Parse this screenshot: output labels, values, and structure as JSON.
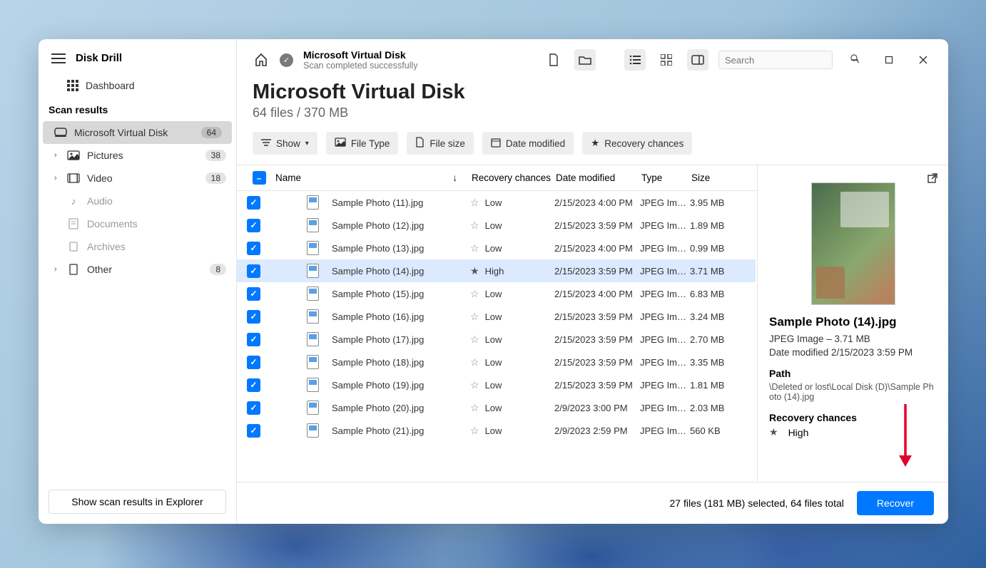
{
  "app": {
    "title": "Disk Drill"
  },
  "sidebar": {
    "dashboard": "Dashboard",
    "section": "Scan results",
    "items": [
      {
        "label": "Microsoft Virtual Disk",
        "badge": "64",
        "active": true
      },
      {
        "label": "Pictures",
        "badge": "38"
      },
      {
        "label": "Video",
        "badge": "18"
      },
      {
        "label": "Audio",
        "dim": true
      },
      {
        "label": "Documents",
        "dim": true
      },
      {
        "label": "Archives",
        "dim": true
      },
      {
        "label": "Other",
        "badge": "8"
      }
    ],
    "explorer_btn": "Show scan results in Explorer"
  },
  "topbar": {
    "disk": "Microsoft Virtual Disk",
    "status": "Scan completed successfully",
    "search_placeholder": "Search"
  },
  "headline": {
    "title": "Microsoft Virtual Disk",
    "sub": "64 files / 370 MB"
  },
  "filters": {
    "show": "Show",
    "file_type": "File Type",
    "file_size": "File size",
    "date_modified": "Date modified",
    "recovery_chances": "Recovery chances"
  },
  "columns": {
    "name": "Name",
    "chances": "Recovery chances",
    "date": "Date modified",
    "type": "Type",
    "size": "Size"
  },
  "rows": [
    {
      "name": "Sample Photo (11).jpg",
      "chance": "Low",
      "date": "2/15/2023 4:00 PM",
      "type": "JPEG Im…",
      "size": "3.95 MB"
    },
    {
      "name": "Sample Photo (12).jpg",
      "chance": "Low",
      "date": "2/15/2023 3:59 PM",
      "type": "JPEG Im…",
      "size": "1.89 MB"
    },
    {
      "name": "Sample Photo (13).jpg",
      "chance": "Low",
      "date": "2/15/2023 4:00 PM",
      "type": "JPEG Im…",
      "size": "0.99 MB"
    },
    {
      "name": "Sample Photo (14).jpg",
      "chance": "High",
      "date": "2/15/2023 3:59 PM",
      "type": "JPEG Im…",
      "size": "3.71 MB",
      "selected": true
    },
    {
      "name": "Sample Photo (15).jpg",
      "chance": "Low",
      "date": "2/15/2023 4:00 PM",
      "type": "JPEG Im…",
      "size": "6.83 MB"
    },
    {
      "name": "Sample Photo (16).jpg",
      "chance": "Low",
      "date": "2/15/2023 3:59 PM",
      "type": "JPEG Im…",
      "size": "3.24 MB"
    },
    {
      "name": "Sample Photo (17).jpg",
      "chance": "Low",
      "date": "2/15/2023 3:59 PM",
      "type": "JPEG Im…",
      "size": "2.70 MB"
    },
    {
      "name": "Sample Photo (18).jpg",
      "chance": "Low",
      "date": "2/15/2023 3:59 PM",
      "type": "JPEG Im…",
      "size": "3.35 MB"
    },
    {
      "name": "Sample Photo (19).jpg",
      "chance": "Low",
      "date": "2/15/2023 3:59 PM",
      "type": "JPEG Im…",
      "size": "1.81 MB"
    },
    {
      "name": "Sample Photo (20).jpg",
      "chance": "Low",
      "date": "2/9/2023 3:00 PM",
      "type": "JPEG Im…",
      "size": "2.03 MB"
    },
    {
      "name": "Sample Photo (21).jpg",
      "chance": "Low",
      "date": "2/9/2023 2:59 PM",
      "type": "JPEG Im…",
      "size": "560 KB"
    }
  ],
  "preview": {
    "name": "Sample Photo (14).jpg",
    "meta1": "JPEG Image – 3.71 MB",
    "meta2": "Date modified 2/15/2023 3:59 PM",
    "path_label": "Path",
    "path": "\\Deleted or lost\\Local Disk (D)\\Sample Photo (14).jpg",
    "chances_label": "Recovery chances",
    "chances": "High"
  },
  "footer": {
    "status": "27 files (181 MB) selected, 64 files total",
    "recover": "Recover"
  }
}
